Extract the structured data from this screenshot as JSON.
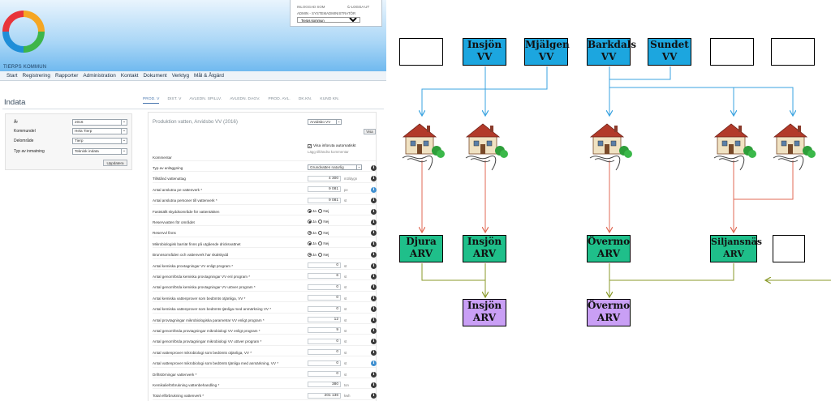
{
  "app": {
    "org_name": "TIERPS KOMMUN",
    "user": {
      "logged_in_label": "INLOGGAD SOM",
      "logout_label": "LOGGA UT",
      "role": "ADMIN - SYSTEMADMINISTRATÖR",
      "municipality": "Tierps kommun"
    },
    "menu": [
      "Start",
      "Registrering",
      "Rapporter",
      "Administration",
      "Kontakt",
      "Dokument",
      "Verktyg",
      "Mål & Åtgärd"
    ],
    "page_title": "Indata",
    "filters": [
      {
        "label": "År",
        "value": "2016"
      },
      {
        "label": "Kommundel",
        "value": "Hela Tierp"
      },
      {
        "label": "Delområde",
        "value": "Tierp"
      },
      {
        "label": "Typ av inmatning",
        "value": "Teknisk indata"
      }
    ],
    "update_button": "Uppdatera",
    "tabs": [
      "PROD. V",
      "DIST. V",
      "AVLEDN. SPILLV.",
      "AVLEDN. DAGV.",
      "PROD. AVL.",
      "DK.KN.",
      "KUND KN."
    ],
    "form": {
      "title": "Produktion vatten, Arvidsbo VV (2016)",
      "unit_select": "Arvidsbo VV",
      "visa_button": "Visa",
      "auto_check_label": "Visa inforuta automatiskt",
      "comment_hint": "Lägg till/ändra kommentar",
      "rows": [
        {
          "label": "Kommentar",
          "kind": "text"
        },
        {
          "label": "Typ av anläggning",
          "kind": "select",
          "value": "Grundvatten naturlig",
          "info": "dark"
        },
        {
          "label": "Tillstånd vattenuttag",
          "kind": "number",
          "value": "4 300",
          "unit": "m3/dygn",
          "info": "dark"
        },
        {
          "label": "Antal anslutna pe vattenverk *",
          "kind": "number",
          "value": "9 081",
          "unit": "pe",
          "info": "blue"
        },
        {
          "label": "Antal anslutna personer till vattenverk *",
          "kind": "number",
          "value": "9 081",
          "unit": "st",
          "info": "dark"
        },
        {
          "label": "Fastställt skyddsområde för vattentäkten",
          "kind": "radio",
          "yes": "Ja",
          "no": "Nej",
          "info": "dark"
        },
        {
          "label": "Reservvatten för området",
          "kind": "radio",
          "yes": "Ja",
          "no": "Nej",
          "info": "dark"
        },
        {
          "label": "Reservvl finns",
          "kind": "radio",
          "yes": "Ja",
          "no": "Nej",
          "info": "dark"
        },
        {
          "label": "Mikrobiologisk barriär finns på utgående dricksvattnet",
          "kind": "radio",
          "yes": "Ja",
          "no": "Nej",
          "info": "dark"
        },
        {
          "label": "Brunnsområden och vattenverk har skalskydd",
          "kind": "radio",
          "yes": "Ja",
          "no": "Nej",
          "info": "dark"
        },
        {
          "label": "Antal kemiska provtagningar VV enligt program *",
          "kind": "number",
          "value": "0",
          "unit": "st",
          "info": "dark"
        },
        {
          "label": "Antal genomförda kemiska provtagningar VV enl program *",
          "kind": "number",
          "value": "6",
          "unit": "st",
          "info": "dark"
        },
        {
          "label": "Antal genomförda kemiska provtagningar VV utöver program *",
          "kind": "number",
          "value": "0",
          "unit": "st",
          "info": "dark"
        },
        {
          "label": "Antal kemiska vattenprover som bedömts otjänliga, VV *",
          "kind": "number",
          "value": "0",
          "unit": "st",
          "info": "dark"
        },
        {
          "label": "Antal kemiska vattenprover som bedömts tjänliga med anmärkning VV *",
          "kind": "number",
          "value": "0",
          "unit": "st",
          "info": "dark"
        },
        {
          "label": "Antal provtagningar mikrobiologiska parametrar VV enligt program *",
          "kind": "number",
          "value": "12",
          "unit": "st",
          "info": "dark"
        },
        {
          "label": "Antal genomförda provtagningar mikrobiologi VV enligt program *",
          "kind": "number",
          "value": "9",
          "unit": "st",
          "info": "dark"
        },
        {
          "label": "Antal genomförda provtagningar mikrobiologi VV utöver program *",
          "kind": "number",
          "value": "0",
          "unit": "st",
          "info": "dark"
        },
        {
          "label": "Antal vattenprover mikrobiologi som bedömts otjänliga, VV *",
          "kind": "number",
          "value": "0",
          "unit": "st",
          "info": "dark"
        },
        {
          "label": "Antal vattenprover mikrobiologi som bedömts tjänliga med anmärkning, VV *",
          "kind": "number",
          "value": "0",
          "unit": "st",
          "info": "blue"
        },
        {
          "label": "Driftstörningar vattenverk *",
          "kind": "number",
          "value": "0",
          "unit": "st",
          "info": "dark"
        },
        {
          "label": "Kemikalieförbrukning vattenbehandling *",
          "kind": "number",
          "value": "380",
          "unit": "ton",
          "info": "dark"
        },
        {
          "label": "Total elförbrukning vattenverk *",
          "kind": "number",
          "value": "201 136",
          "unit": "kwh",
          "info": "dark"
        }
      ]
    }
  },
  "diagram": {
    "sources": [
      {
        "name": "Insjön",
        "kind": "VV"
      },
      {
        "name": "Mjälgen",
        "kind": "VV"
      },
      {
        "name": "Barkdals",
        "kind": "VV"
      },
      {
        "name": "Sundet",
        "kind": "VV"
      }
    ],
    "treatment": [
      {
        "name": "Djura",
        "kind": "ARV"
      },
      {
        "name": "Insjön",
        "kind": "ARV"
      },
      {
        "name": "Övermo",
        "kind": "ARV"
      },
      {
        "name": "Siljansnäs",
        "kind": "ARV"
      }
    ],
    "outlets": [
      {
        "name": "Insjön",
        "kind": "ARV"
      },
      {
        "name": "Övermo",
        "kind": "ARV"
      }
    ],
    "colors": {
      "source": "#1ca6df",
      "treatment": "#1fbf8a",
      "outlet": "#c99ff5",
      "supply_line": "#3aa3e0",
      "sewage_line": "#e06a55",
      "effluent_line": "#8a9a2a"
    }
  }
}
